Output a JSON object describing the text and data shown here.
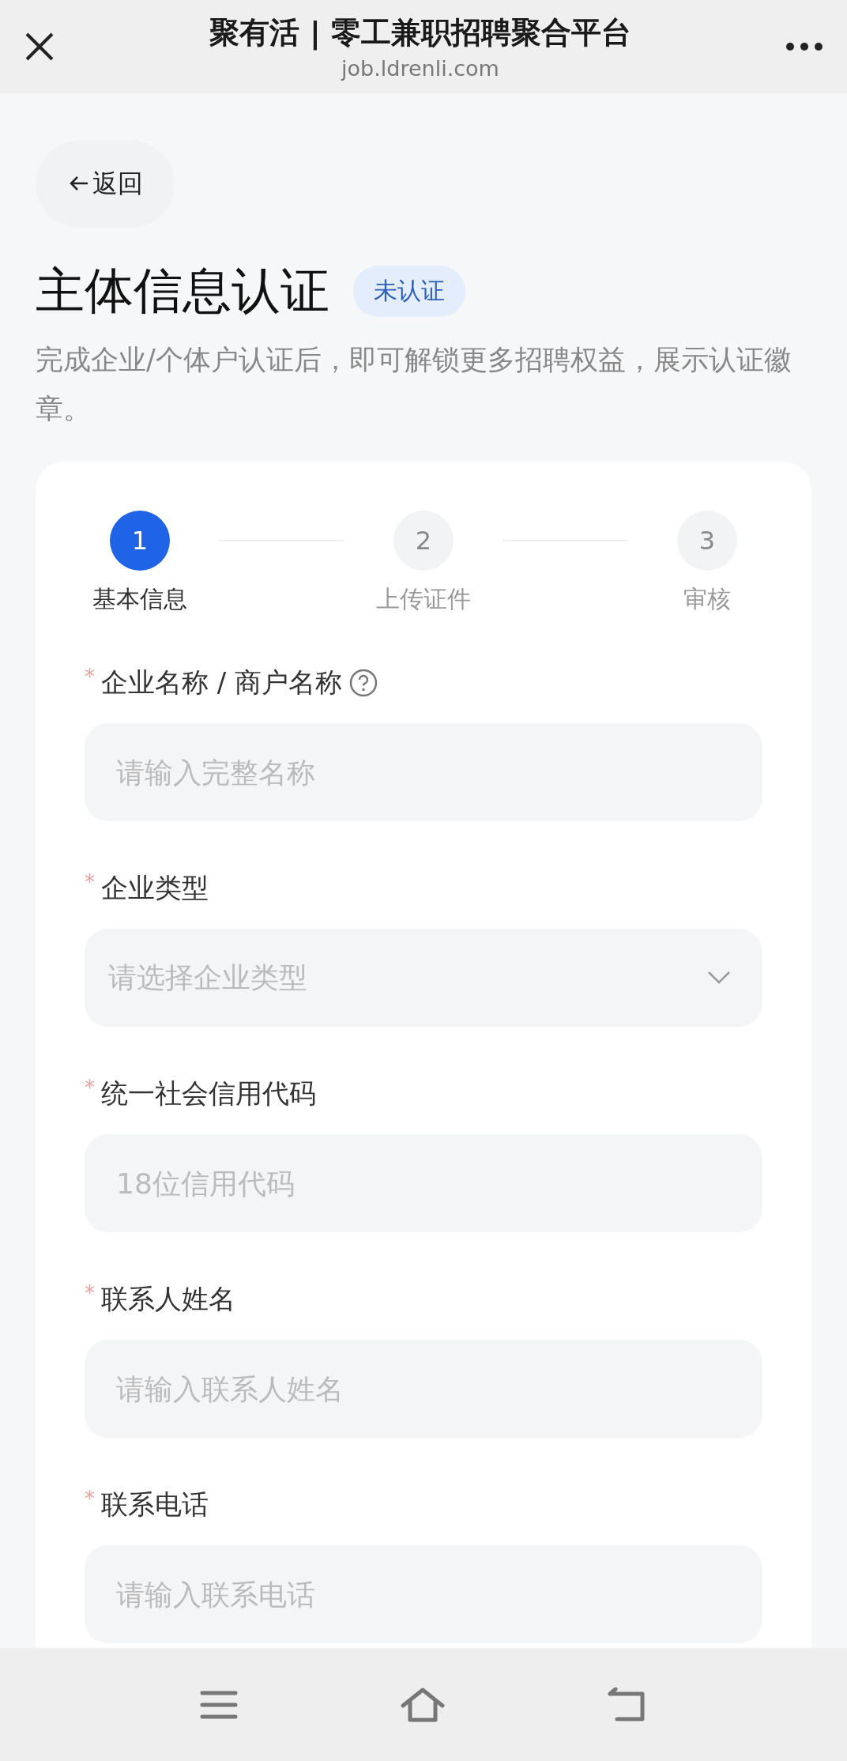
{
  "header": {
    "title": "聚有活 | 零工兼职招聘聚合平台",
    "url": "job.ldrenli.com"
  },
  "back": {
    "label": "返回"
  },
  "page": {
    "title": "主体信息认证",
    "badge": "未认证",
    "description": "完成企业/个体户认证后，即可解锁更多招聘权益，展示认证徽章。"
  },
  "steps": [
    {
      "number": "1",
      "label": "基本信息",
      "selected": true
    },
    {
      "number": "2",
      "label": "上传证件",
      "selected": false
    },
    {
      "number": "3",
      "label": "审核",
      "selected": false
    }
  ],
  "fields": [
    {
      "kind": "text",
      "required_mark": "*",
      "label": "企业名称 / 商户名称",
      "help": true,
      "placeholder": "请输入完整名称"
    },
    {
      "kind": "select",
      "required_mark": "*",
      "label": "企业类型",
      "help": false,
      "placeholder": "请选择企业类型"
    },
    {
      "kind": "text",
      "required_mark": "*",
      "label": "统一社会信用代码",
      "help": false,
      "placeholder": "18位信用代码"
    },
    {
      "kind": "text",
      "required_mark": "*",
      "label": "联系人姓名",
      "help": false,
      "placeholder": "请输入联系人姓名"
    },
    {
      "kind": "text",
      "required_mark": "*",
      "label": "联系电话",
      "help": false,
      "placeholder": "请输入联系电话"
    }
  ]
}
